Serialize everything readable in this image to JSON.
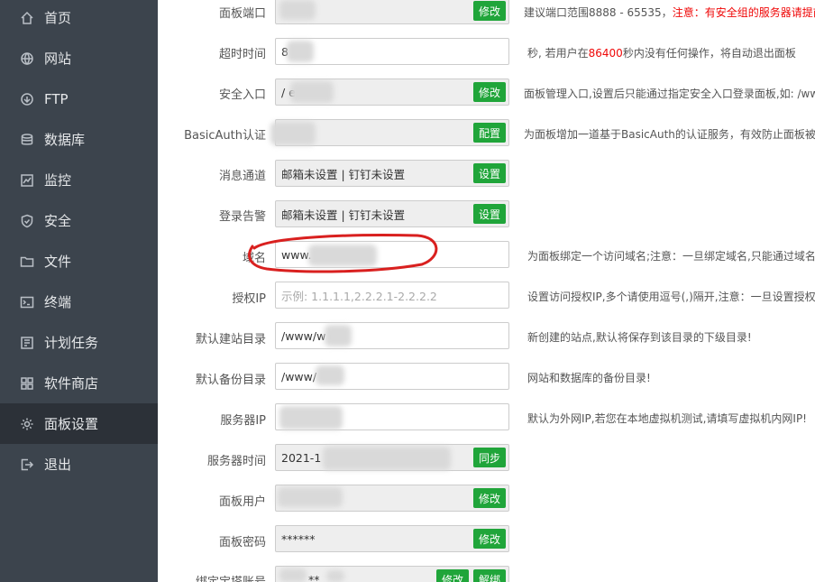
{
  "sidebar": {
    "items": [
      {
        "label": "首页",
        "icon": "home-icon"
      },
      {
        "label": "网站",
        "icon": "globe-icon"
      },
      {
        "label": "FTP",
        "icon": "ftp-icon"
      },
      {
        "label": "数据库",
        "icon": "database-icon"
      },
      {
        "label": "监控",
        "icon": "monitor-icon"
      },
      {
        "label": "安全",
        "icon": "shield-icon"
      },
      {
        "label": "文件",
        "icon": "folder-icon"
      },
      {
        "label": "终端",
        "icon": "terminal-icon"
      },
      {
        "label": "计划任务",
        "icon": "calendar-icon"
      },
      {
        "label": "软件商店",
        "icon": "apps-icon"
      },
      {
        "label": "面板设置",
        "icon": "gear-icon",
        "active": true
      },
      {
        "label": "退出",
        "icon": "logout-icon"
      }
    ]
  },
  "settings": {
    "panel_port": {
      "label": "面板端口",
      "value": "",
      "button": "修改",
      "hint_prefix": "建议端口范围8888 - 65535，",
      "hint_red": "注意：有安全组的服务器请提前"
    },
    "timeout": {
      "label": "超时时间",
      "value": "8",
      "hint_prefix": "秒, 若用户在",
      "hint_red": "86400",
      "hint_suffix": "秒内没有任何操作，将自动退出面板"
    },
    "entry": {
      "label": "安全入口",
      "value": "/          e",
      "button": "修改",
      "hint": "面板管理入口,设置后只能通过指定安全入口登录面板,如: /ww"
    },
    "basicauth": {
      "label": "BasicAuth认证",
      "value": "",
      "button": "配置",
      "hint": "为面板增加一道基于BasicAuth的认证服务，有效防止面板被扫"
    },
    "message_channel": {
      "label": "消息通道",
      "value": "邮箱未设置 | 钉钉未设置",
      "button": "设置"
    },
    "login_alert": {
      "label": "登录告警",
      "value": "邮箱未设置 | 钉钉未设置",
      "button": "设置"
    },
    "domain": {
      "label": "域名",
      "value": "www.              .com",
      "hint": "为面板绑定一个访问域名;注意：一旦绑定域名,只能通过域名"
    },
    "auth_ip": {
      "label": "授权IP",
      "placeholder": "示例: 1.1.1.1,2.2.2.1-2.2.2.2",
      "hint": "设置访问授权IP,多个请使用逗号(,)隔开,注意：一旦设置授权IP"
    },
    "site_dir": {
      "label": "默认建站目录",
      "value": "/www/w        ot",
      "hint": "新创建的站点,默认将保存到该目录的下级目录!"
    },
    "backup_dir": {
      "label": "默认备份目录",
      "value": "/www/",
      "hint": "网站和数据库的备份目录!"
    },
    "server_ip": {
      "label": "服务器IP",
      "value": "",
      "hint": "默认为外网IP,若您在本地虚拟机测试,请填写虚拟机内网IP!"
    },
    "server_time": {
      "label": "服务器时间",
      "value": "2021-1",
      "button": "同步"
    },
    "panel_user": {
      "label": "面板用户",
      "value": "",
      "button": "修改"
    },
    "panel_password": {
      "label": "面板密码",
      "value": "******",
      "button": "修改"
    },
    "bind_account": {
      "label": "绑定宝塔账号",
      "value": "**",
      "button_modify": "修改",
      "button_unbind": "解绑"
    }
  },
  "colors": {
    "sidebar_bg": "#3c444d",
    "sidebar_active": "#2c3138",
    "accent_green": "#20a53a",
    "warning_red": "#ef0808",
    "annotation_red": "#d9201f"
  }
}
